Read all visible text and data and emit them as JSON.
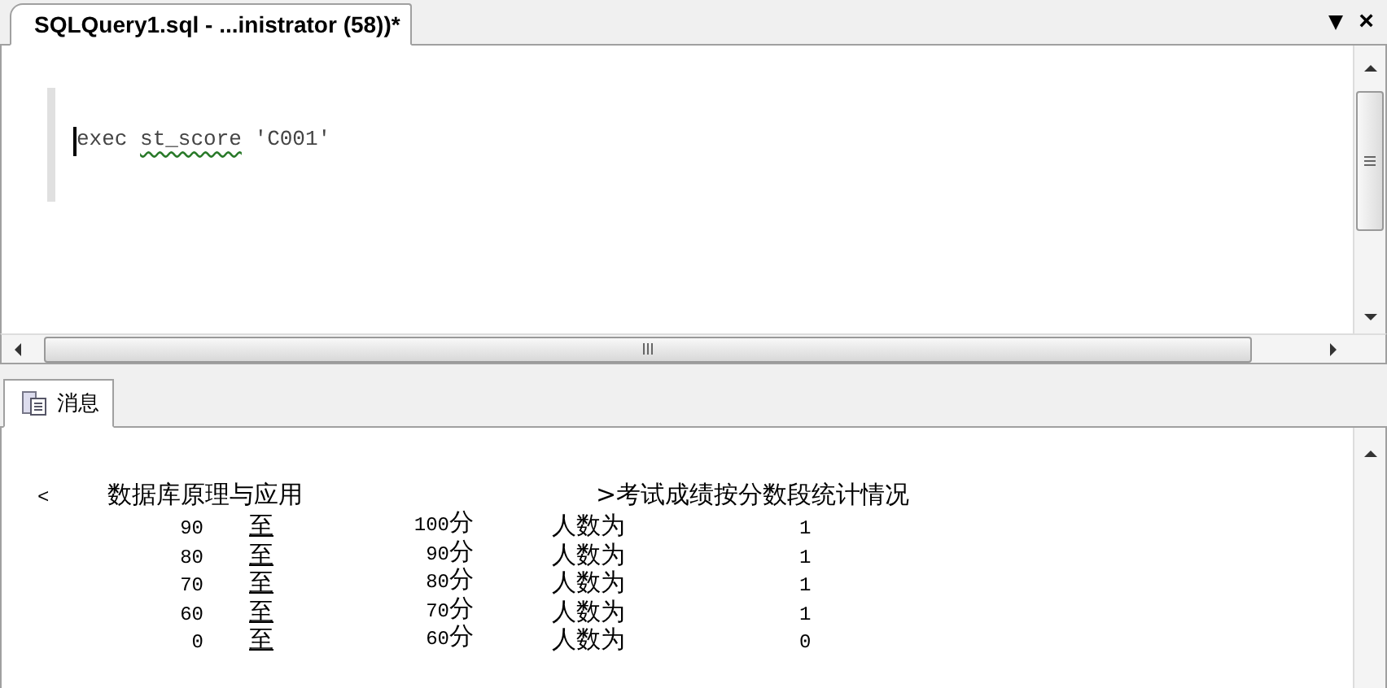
{
  "document_tab": {
    "title": "SQLQuery1.sql - ...inistrator (58))*",
    "selected": true
  },
  "window_buttons": [
    "▾",
    "×"
  ],
  "editor": {
    "tokens": [
      {
        "text": "exec",
        "error": false
      },
      {
        "text": "st_score",
        "error": true
      },
      {
        "text": "'C001'",
        "error": false
      }
    ]
  },
  "results_tabs": [
    {
      "label": "消息",
      "selected": true
    }
  ],
  "messages": {
    "header": {
      "open": "<",
      "course": "数据库原理与应用",
      "title": ">考试成绩按分数段统计情况"
    },
    "rows": [
      {
        "from": "90",
        "to_word": "至",
        "to": "100分",
        "label": "人数为",
        "count": "1"
      },
      {
        "from": "80",
        "to_word": "至",
        "to": "90分",
        "label": "人数为",
        "count": "1"
      },
      {
        "from": "70",
        "to_word": "至",
        "to": "80分",
        "label": "人数为",
        "count": "1"
      },
      {
        "from": "60",
        "to_word": "至",
        "to": "70分",
        "label": "人数为",
        "count": "1"
      },
      {
        "from": "0",
        "to_word": "至",
        "to": "60分",
        "label": "人数为",
        "count": "0"
      }
    ]
  }
}
